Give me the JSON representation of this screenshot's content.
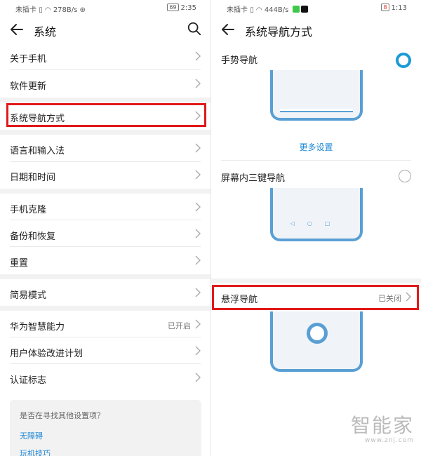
{
  "left": {
    "status": {
      "carrier": "未插卡",
      "speed": "278B/s",
      "battery": "69",
      "time": "2:35"
    },
    "title": "系统",
    "items": [
      {
        "label": "关于手机"
      },
      {
        "label": "软件更新"
      },
      {
        "label": "系统导航方式"
      },
      {
        "label": "语言和输入法"
      },
      {
        "label": "日期和时间"
      },
      {
        "label": "手机克隆"
      },
      {
        "label": "备份和恢复"
      },
      {
        "label": "重置"
      },
      {
        "label": "简易模式"
      },
      {
        "label": "华为智慧能力",
        "value": "已开启"
      },
      {
        "label": "用户体验改进计划"
      },
      {
        "label": "认证标志"
      }
    ],
    "card": {
      "question": "是否在寻找其他设置项？",
      "link1": "无障碍",
      "link2": "玩机技巧"
    }
  },
  "right": {
    "status": {
      "carrier": "未插卡",
      "speed": "444B/s",
      "battery": "8",
      "time": "1:13"
    },
    "title": "系统导航方式",
    "gesture": {
      "label": "手势导航",
      "selected": true,
      "more": "更多设置"
    },
    "three_key": {
      "label": "屏幕内三键导航",
      "selected": false
    },
    "float_nav": {
      "label": "悬浮导航",
      "value": "已关闭"
    }
  },
  "watermark": {
    "brand": "智能家",
    "url": "www.znj.com"
  },
  "colors": {
    "accent": "#1a9ad6",
    "highlight": "#e01919",
    "phone_frame": "#5a9fd4"
  }
}
